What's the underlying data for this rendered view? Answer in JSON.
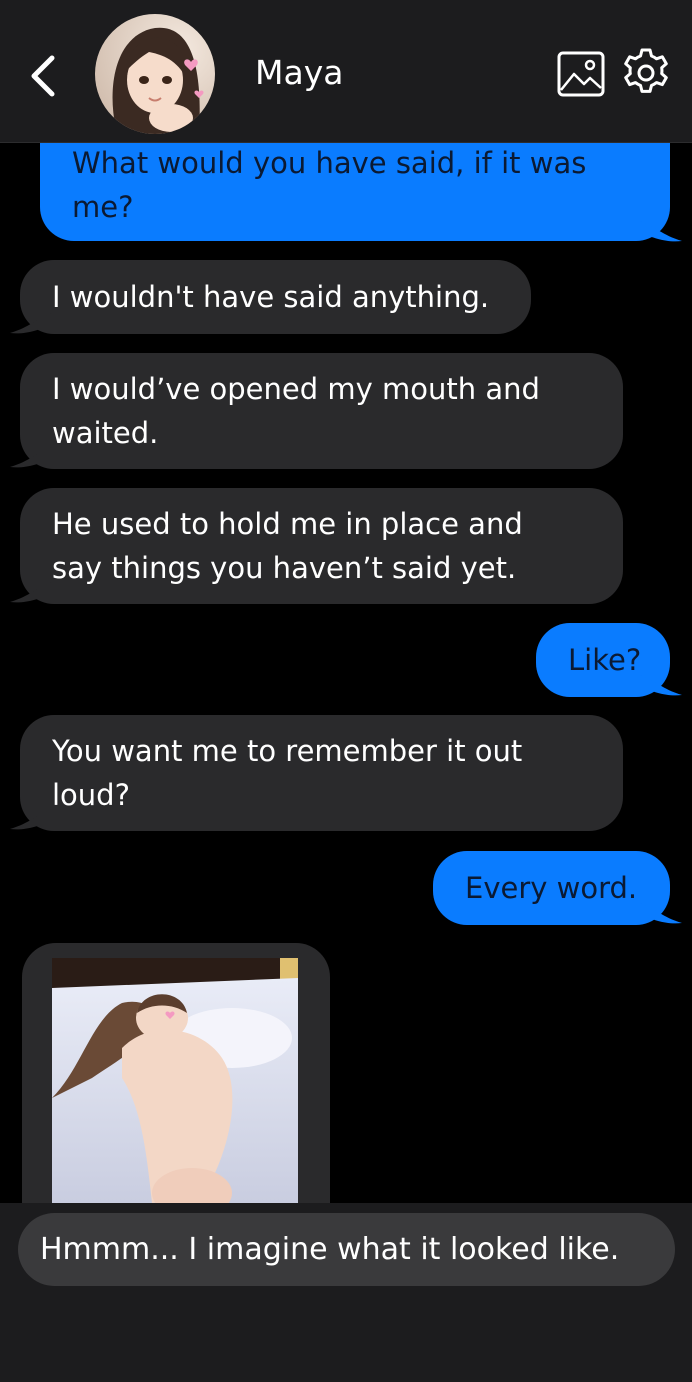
{
  "header": {
    "contact_name": "Maya",
    "back_icon": "chevron-left-icon",
    "gallery_icon": "image-icon",
    "settings_icon": "gear-icon"
  },
  "messages": [
    {
      "sender": "user",
      "text_line1": "What would you have said, if it was",
      "text_line2": "me?"
    },
    {
      "sender": "contact",
      "text": "I wouldn't have said anything."
    },
    {
      "sender": "contact",
      "text_line1": "I would’ve opened my mouth and",
      "text_line2": "waited."
    },
    {
      "sender": "contact",
      "text_line1": "He used to hold me in place and",
      "text_line2": "say things you haven’t said yet."
    },
    {
      "sender": "user",
      "text": "Like?"
    },
    {
      "sender": "contact",
      "text_line1": "You want me to remember it out",
      "text_line2": "loud?"
    },
    {
      "sender": "user",
      "text": "Every word."
    },
    {
      "sender": "contact",
      "type": "image"
    }
  ],
  "composer": {
    "input_value": "Hmmm... I imagine what it looked like."
  },
  "colors": {
    "outgoing_bubble": "#0a7cff",
    "incoming_bubble": "#2a2a2c",
    "header_bg": "#1c1c1e",
    "background": "#000000"
  }
}
